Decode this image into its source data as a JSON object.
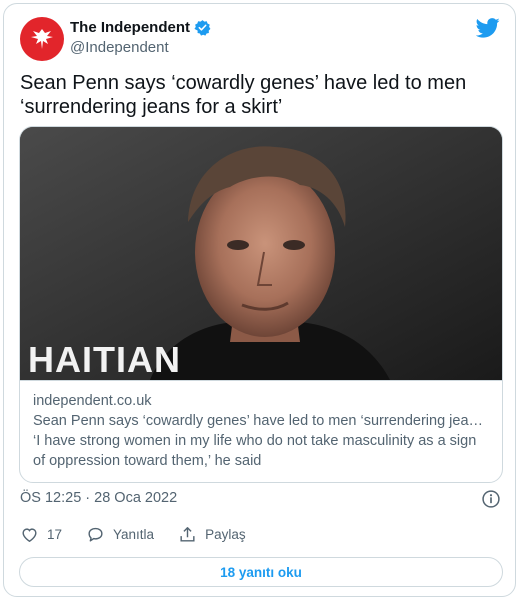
{
  "author": {
    "name": "The Independent",
    "handle": "@Independent",
    "brand_color": "#e2252b"
  },
  "tweet": {
    "text": "Sean Penn says ‘cowardly genes’ have led to men ‘surrendering jeans for a skirt’"
  },
  "card": {
    "image_text": "HAITIAN",
    "domain": "independent.co.uk",
    "title": "Sean Penn says ‘cowardly genes’ have led to men ‘surrendering jeans for…",
    "description": "‘I have strong women in my life who do not take masculinity as a sign of oppression toward them,’ he said"
  },
  "meta": {
    "timestamp": "ÖS 12:25 · 28 Oca 2022"
  },
  "actions": {
    "likes": "17",
    "reply_label": "Yanıtla",
    "share_label": "Paylaş"
  },
  "replies_button": "18 yanıtı oku",
  "colors": {
    "accent": "#1d9bf0",
    "muted": "#536471",
    "border": "#cfd9de"
  },
  "icons": [
    "independent-eagle-logo",
    "verified-badge-icon",
    "twitter-bird-icon",
    "info-icon",
    "heart-icon",
    "reply-icon",
    "share-icon"
  ]
}
